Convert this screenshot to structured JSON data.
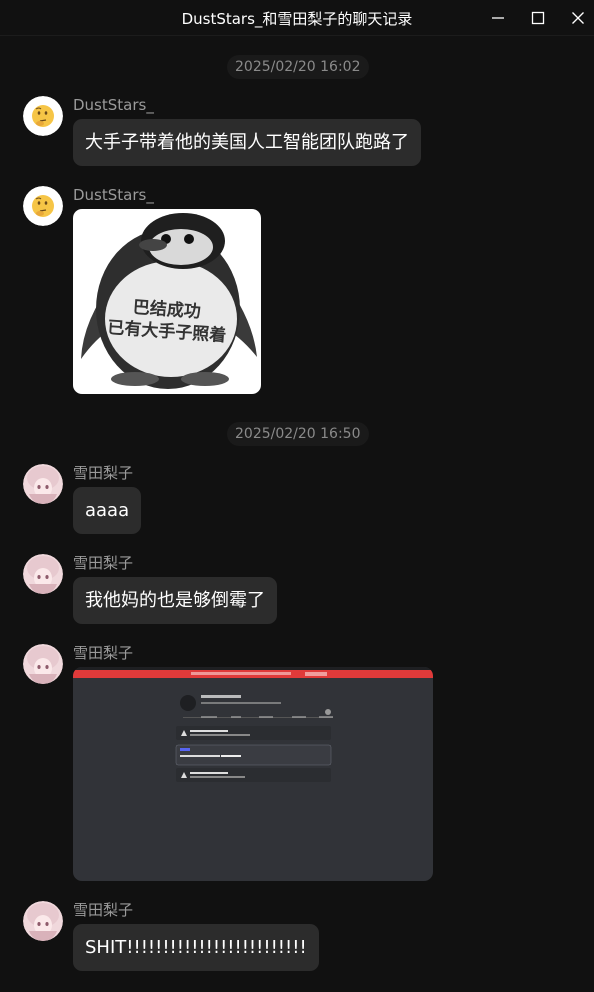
{
  "window": {
    "title": "DustStars_和雪田梨子的聊天记录",
    "icons": [
      "minimize-icon",
      "maximize-icon",
      "close-icon"
    ]
  },
  "messages": {
    "time1": "2025/02/20 16:02",
    "time2": "2025/02/20 16:50",
    "m1": {
      "sender": "DustStars_",
      "text": "大手子带着他的美国人工智能团队跑路了"
    },
    "m2": {
      "sender": "DustStars_",
      "image_caption_line1": "巴结成功",
      "image_caption_line2": "已有大手子照着"
    },
    "m3": {
      "sender": "雪田梨子",
      "text": "aaaa"
    },
    "m4": {
      "sender": "雪田梨子",
      "text": "我他妈的也是够倒霉了"
    },
    "m5": {
      "sender": "雪田梨子"
    },
    "m6": {
      "sender": "雪田梨子",
      "text": "SHIT!!!!!!!!!!!!!!!!!!!!!!!!!"
    }
  },
  "colors": {
    "background": "#111111",
    "bubble": "#2c2c2c",
    "name": "#9a9a9a",
    "time_text": "#8a8a8a",
    "screenshot_banner": "#e03a3a",
    "screenshot_bg": "#313338"
  }
}
